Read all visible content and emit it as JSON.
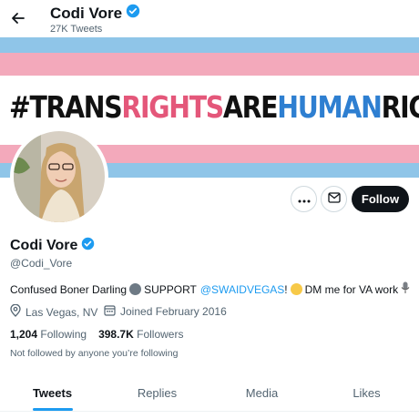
{
  "header": {
    "name": "Codi Vore",
    "tweet_count": "27K Tweets",
    "back_icon": "arrow-left-icon",
    "verified_icon": "verified-badge-icon"
  },
  "banner": {
    "text_black_1": "#TRANS",
    "text_pink": "RIGHTS",
    "text_black_2": "ARE",
    "text_blue": "HUMAN",
    "text_black_3": "RIGHTS",
    "colors": {
      "light_blue": "#8fc5e8",
      "pink": "#f3a9bb",
      "white": "#ffffff",
      "text_pink": "#e4577a",
      "text_blue": "#2e7fd1"
    }
  },
  "actions": {
    "more_icon": "more-horizontal-icon",
    "message_icon": "mail-icon",
    "follow_label": "Follow"
  },
  "profile": {
    "display_name": "Codi Vore",
    "handle": "@Codi_Vore",
    "bio_part1": "Confused Boner Darling",
    "bio_part2": "SUPPORT",
    "bio_mention": "@SWAIDVEGAS",
    "bio_part3": "!",
    "bio_part4": "DM me for VA work",
    "location": "Las Vegas, NV",
    "joined": "Joined February 2016",
    "following_count": "1,204",
    "following_label": "Following",
    "followers_count": "398.7K",
    "followers_label": "Followers",
    "not_followed": "Not followed by anyone you’re following"
  },
  "tabs": [
    {
      "label": "Tweets",
      "active": true
    },
    {
      "label": "Replies",
      "active": false
    },
    {
      "label": "Media",
      "active": false
    },
    {
      "label": "Likes",
      "active": false
    }
  ],
  "colors": {
    "accent": "#1d9bf0",
    "text_primary": "#0f1419",
    "text_secondary": "#536471"
  }
}
